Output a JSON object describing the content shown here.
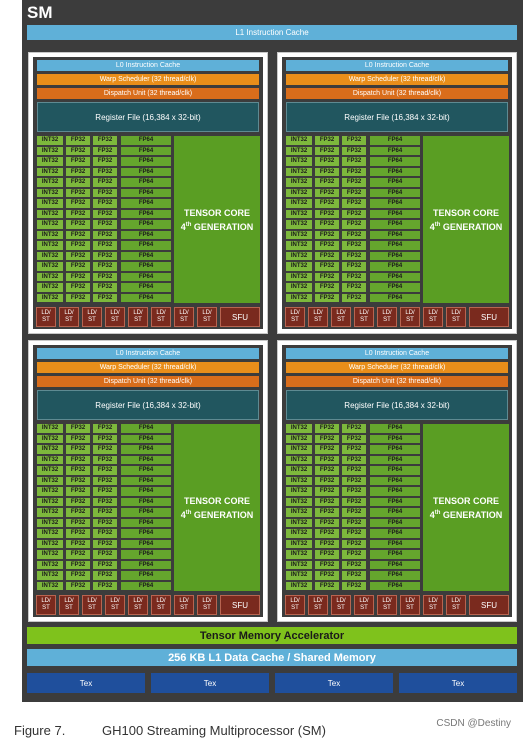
{
  "sm": {
    "title": "SM",
    "l1_instruction_cache": "L1 Instruction Cache",
    "partition": {
      "l0_instruction_cache": "L0 Instruction Cache",
      "warp_scheduler": "Warp Scheduler (32 thread/clk)",
      "dispatch_unit": "Dispatch Unit (32 thread/clk)",
      "register_file": "Register File (16,384 x 32-bit)",
      "int32_label": "INT32",
      "fp32_label": "FP32",
      "fp64_label": "FP64",
      "unit_rows": 16,
      "tensor_core_line1": "TENSOR CORE",
      "tensor_core_ordinal": "4",
      "tensor_core_suffix": "th",
      "tensor_core_line2": "GENERATION",
      "ldst_top": "LD/",
      "ldst_bottom": "ST",
      "ldst_count": 8,
      "sfu": "SFU"
    },
    "partition_count": 4,
    "tensor_memory_accelerator": "Tensor Memory Accelerator",
    "l1_data_cache": "256 KB L1 Data Cache / Shared Memory",
    "tex_units": [
      "Tex",
      "Tex",
      "Tex",
      "Tex"
    ],
    "colors": {
      "background": "#3c3c3c",
      "cache": "#5fb0d8",
      "warp_scheduler": "#e98e1a",
      "dispatch": "#d96d1b",
      "register_file": "#21565f",
      "core": "#7db83c",
      "tensor_core": "#5a9e23",
      "ldst_sfu": "#7a2a1e",
      "tma": "#7fc21c",
      "tex": "#1f4f9c"
    }
  },
  "caption": {
    "figure_number": "Figure 7.",
    "title": "GH100 Streaming Multiprocessor (SM)"
  },
  "watermark": "CSDN @Destiny"
}
